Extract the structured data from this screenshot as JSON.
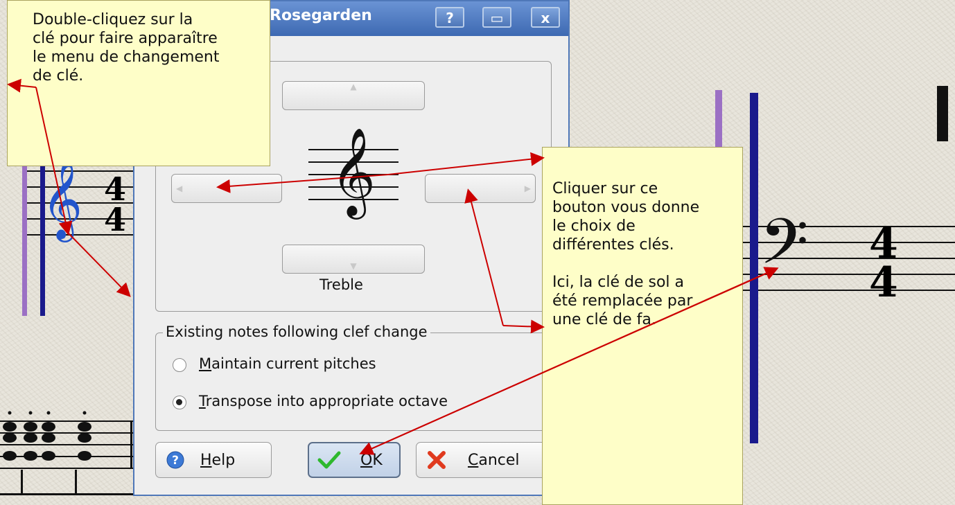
{
  "window": {
    "title": "Rosegarden",
    "help_glyph": "?",
    "maximize_glyph": "▭",
    "close_glyph": "x"
  },
  "clef": {
    "current_name": "Treble",
    "up_button": "▲",
    "down_button": "▼",
    "left_button": "◀",
    "right_button": "▶"
  },
  "existing_notes": {
    "legend": "Existing notes following clef change",
    "options": [
      {
        "mnemonic": "M",
        "rest": "aintain current pitches",
        "selected": false
      },
      {
        "mnemonic": "T",
        "rest": "ranspose into appropriate octave",
        "selected": true
      }
    ]
  },
  "buttons": {
    "help": {
      "mnemonic": "H",
      "rest": "elp"
    },
    "ok": {
      "mnemonic": "O",
      "rest": "K"
    },
    "cancel": {
      "mnemonic": "C",
      "rest": "ancel"
    }
  },
  "notes": {
    "top_left": "Double-cliquez sur la\nclé pour faire apparaître\nle menu de changement\nde clé.",
    "right": "Cliquer sur ce\nbouton vous donne\nle choix de\ndifférentes clés.\n\nIci, la clé de sol a\nété remplacée par\nune clé de fa."
  },
  "music": {
    "treble_clef_glyph": "𝄞",
    "bass_clef_glyph": "𝄢",
    "time_sig_top": "4",
    "time_sig_bottom": "4",
    "accent_blue": "#1a1a8c",
    "accent_purple": "#9b70c4",
    "selected_clef_color": "#2255cc"
  }
}
